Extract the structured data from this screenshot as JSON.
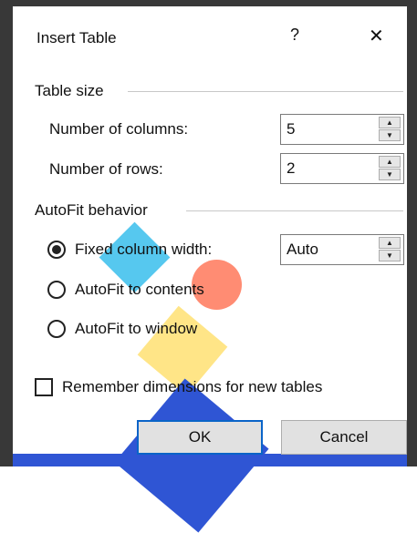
{
  "dialog": {
    "title": "Insert Table",
    "help_label": "?",
    "close_label": "✕"
  },
  "table_size": {
    "group_label": "Table size",
    "columns_label": "Number of columns:",
    "columns_value": "5",
    "rows_label": "Number of rows:",
    "rows_value": "2"
  },
  "autofit": {
    "group_label": "AutoFit behavior",
    "fixed_label": "Fixed column width:",
    "fixed_value": "Auto",
    "contents_label": "AutoFit to contents",
    "window_label": "AutoFit to window",
    "selected": "fixed"
  },
  "remember_label": "Remember dimensions for new tables",
  "buttons": {
    "ok": "OK",
    "cancel": "Cancel"
  },
  "icons": {
    "spin_up": "▲",
    "spin_down": "▼"
  },
  "colors": {
    "accent": "#0a64c8",
    "frame": "#383838"
  }
}
